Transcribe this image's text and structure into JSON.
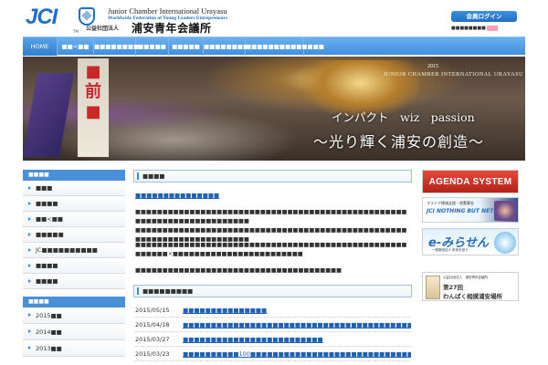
{
  "header": {
    "logo_text": "JCI",
    "org_en": "Junior Chamber International Urayasu",
    "org_tagline": "Worldwide Federation of Young Leaders Entrepreneurs",
    "tm": "TM",
    "corp_prefix": "公益社団法人",
    "org_jp": "浦安青年会議所",
    "login_label": "会員ログイン",
    "social_text": "■■■■■■■■"
  },
  "nav": {
    "items": [
      "HOME",
      "■■<■■",
      "■■■■■■■■",
      "■■■■■",
      "■■■■■",
      "■■■■■■■■",
      "■■■■■■■■■■■■■■"
    ]
  },
  "banner": {
    "year": "2015",
    "subtitle": "JUNIOR CHAMBER INTERNATIONAL URAYASU",
    "title1": "インパクト　wiz　passion",
    "title2": "～光り輝く浦安の創造～",
    "side_red_text": "■前■"
  },
  "sidebar": {
    "head1": "■■■■",
    "items": [
      "■■■",
      "■■■■",
      "■■<■■",
      "■■■■■",
      "JC■■■■■■■■■■",
      "■■■■",
      "■■■■"
    ],
    "head2": "■■■■",
    "archives": [
      "2015■■",
      "2014■■",
      "2013■■"
    ]
  },
  "main": {
    "heading": "■■■■",
    "link": "■■■■■■■■■■■■■■■",
    "para1": "■■■■■■■■■■■■■■■■■■■■■■■■■■■■■■■■■■■■■■■■■■■■■■■■■■■■■■■■■■■■■■■■■■■■■■■",
    "para2": "■■■■■■■■■■■■■■■■■■■■■■■■■■■■■■■■■■■■■■■■■■■■■■■■■■■■■■■■■■■■■■■■■■■■■■■",
    "para3": "■■■■■■■■■■■■■■■■■■■■■■■■■■■■■■■■■■■■■■■■■■■■■■■■■■■■■■■■×■■■■■■■■■■■■■■■■■■■■■■■■",
    "para4": "■■■■■■■■■■■■■■■■■■■■■■■■■■■■■■■■■■■■■■",
    "news_heading": "■■■■■■■■■",
    "news": [
      {
        "date": "2015/05/15",
        "title": "■■■■■■■■■■■■■■■"
      },
      {
        "date": "2015/04/18",
        "title": "■■■■■■■■■■■■■■■■■■■■■■■■■■■■■■■■■■■■■■■■■■■■"
      },
      {
        "date": "2015/03/27",
        "title": "■■■■■■■■■■■■■■■■■■■■■■■■■"
      },
      {
        "date": "2015/03/23",
        "title": "■■■■■■■■■■100■■■■■■■■■■■■■■■■■■■■■■■■■■■■■■■■■■■"
      }
    ]
  },
  "ads": {
    "agenda": "AGENDA SYSTEM",
    "nbn_small": "マラリア撲滅支援・啓蒙募金",
    "nbn_big": "JCI NOTHING BUT NETS",
    "emirasen_big": "e-みらせん",
    "emirasen_small": "一般財団法人 未来を担う",
    "wanpaku_small": "公益社団法人　浦安青年会議所",
    "wanpaku_1": "第27回",
    "wanpaku_2": "わんぱく相撲浦安場所"
  }
}
